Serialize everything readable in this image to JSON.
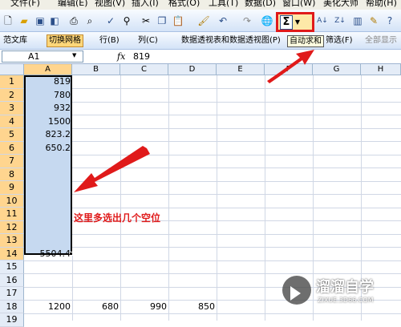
{
  "menu": [
    "文件(F)",
    "编辑(E)",
    "视图(V)",
    "插入(I)",
    "格式(O)",
    "工具(T)",
    "数据(D)",
    "窗口(W)",
    "美化大师",
    "帮助(H)"
  ],
  "toolbar2": {
    "items": [
      "范文库",
      "切换网格",
      "行(B)",
      "列(C)",
      "数据透视表和数据透视图(P)",
      "筛选(F)",
      "全部显示"
    ]
  },
  "tooltip": "自动求和",
  "sum_symbol": "Σ",
  "formula_bar": {
    "name_box": "A1",
    "fx": "fx",
    "value": "819"
  },
  "columns": [
    "A",
    "B",
    "C",
    "D",
    "E",
    "F",
    "G",
    "H"
  ],
  "rows": [
    "1",
    "2",
    "3",
    "4",
    "5",
    "6",
    "7",
    "8",
    "9",
    "10",
    "11",
    "12",
    "13",
    "14",
    "15",
    "16",
    "17",
    "18",
    "19"
  ],
  "cells": {
    "A1": "819",
    "A2": "780",
    "A3": "932",
    "A4": "1500",
    "A5": "823.2",
    "A6": "650.2",
    "A14": "5504.4",
    "A18": "1200",
    "B18": "680",
    "C18": "990",
    "D18": "850"
  },
  "annotation": "这里多选出几个空位",
  "watermark": {
    "title": "溜溜自学",
    "subtitle": "ZIXUE.3D66.COM"
  },
  "colors": {
    "highlight_red": "#e01a1a",
    "selection_fill": "#c6d9f0",
    "header_selected": "#ffd58f"
  }
}
